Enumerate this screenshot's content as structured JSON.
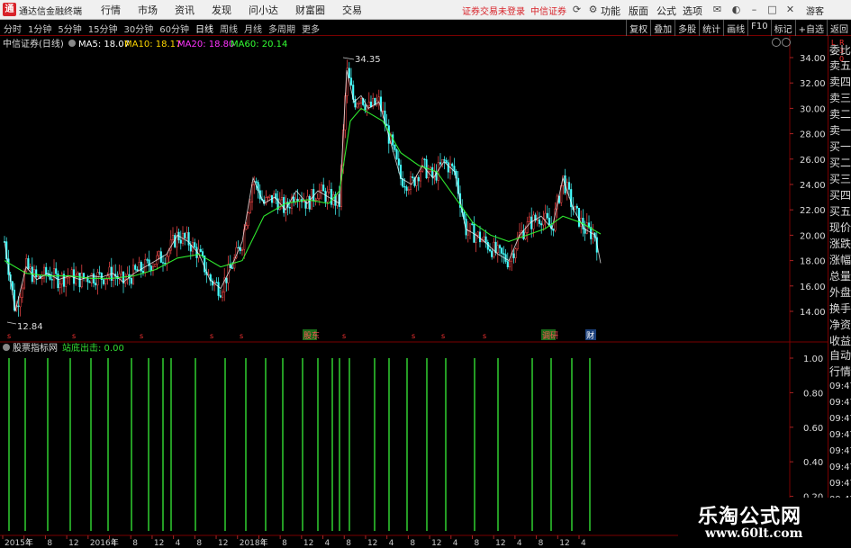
{
  "titlebar": {
    "logo": "通",
    "app_name": "通达信金融终端",
    "menu": [
      "行情",
      "市场",
      "资讯",
      "发现",
      "问小达",
      "财富圈",
      "交易"
    ],
    "status": "证券交易未登录",
    "broker": "中信证券",
    "right_menu": [
      "功能",
      "版面",
      "公式",
      "选项"
    ],
    "guest": "游客"
  },
  "toolbar": {
    "periods": [
      "分时",
      "1分钟",
      "5分钟",
      "15分钟",
      "30分钟",
      "60分钟",
      "日线",
      "周线",
      "月线",
      "多周期",
      "更多"
    ],
    "active_period": "日线",
    "right_buttons": [
      "复权",
      "叠加",
      "多股",
      "统计",
      "画线",
      "F10",
      "标记",
      "+自选",
      "返回"
    ]
  },
  "main_panel": {
    "title": "中信证券(日线)",
    "ma": [
      {
        "label": "MA5: 18.07",
        "color": "#ffffff"
      },
      {
        "label": "MA10: 18.17",
        "color": "#ffd700"
      },
      {
        "label": "MA20: 18.80",
        "color": "#ff33ff"
      },
      {
        "label": "MA60: 20.14",
        "color": "#33ff33"
      }
    ],
    "high_label": "34.35",
    "low_label": "12.84",
    "events": [
      "股东",
      "调研",
      "财"
    ]
  },
  "indicator_panel": {
    "title": "股票指标网",
    "value_label": "站底出击: 0.00"
  },
  "sidebar": {
    "corner": [
      "L",
      "R",
      "3",
      "0"
    ],
    "items": [
      "委比",
      "卖五",
      "卖四",
      "卖三",
      "卖二",
      "卖一",
      "买一",
      "买二",
      "买三",
      "买四",
      "买五",
      "现价",
      "涨跌",
      "涨幅",
      "总量",
      "外盘",
      "换手",
      "净资",
      "收益",
      "自动",
      "行情",
      "09:47",
      "09:47",
      "09:47",
      "09:47",
      "09:47",
      "09:47",
      "09:47",
      "09:47"
    ]
  },
  "x_axis_labels": [
    "2015年",
    "4",
    "8",
    "12",
    "2016年",
    "4",
    "8",
    "12",
    "4",
    "8",
    "12",
    "2018年",
    "4",
    "8",
    "12",
    "4",
    "8",
    "12",
    "4",
    "8",
    "12",
    "4",
    "8",
    "12",
    "4",
    "8",
    "12",
    "4"
  ],
  "watermark": {
    "line1": "乐淘公式网",
    "line2": "www.60lt.com"
  },
  "chart_data": [
    {
      "type": "line",
      "chart_role": "price",
      "y_ticks": [
        34.0,
        32.0,
        30.0,
        28.0,
        26.0,
        24.0,
        22.0,
        20.0,
        18.0,
        16.0,
        14.0
      ],
      "ylim": [
        12.84,
        34.35
      ],
      "series": [
        {
          "name": "MA5",
          "color": "#ffffff",
          "x": [
            0,
            12,
            24,
            36,
            48,
            60,
            72,
            84,
            96,
            108,
            120,
            132,
            144,
            156,
            168,
            180,
            192,
            204,
            216,
            228,
            240,
            252,
            264,
            276,
            288,
            300,
            312,
            324,
            336,
            348,
            360,
            372,
            380,
            388,
            396,
            404,
            416,
            428,
            440,
            452,
            464,
            476,
            488,
            500,
            512,
            524,
            536,
            548,
            560,
            572,
            584,
            596,
            608,
            620,
            632,
            644,
            656,
            662
          ],
          "values": [
            19.5,
            14.0,
            17.5,
            16.5,
            17.0,
            16.5,
            16.8,
            16.5,
            16.8,
            16.7,
            17.0,
            16.3,
            17.0,
            17.5,
            18.0,
            18.5,
            20.0,
            19.5,
            18.5,
            16.5,
            15.8,
            17.5,
            19.5,
            24.5,
            22.5,
            23.0,
            22.0,
            23.5,
            22.5,
            23.5,
            23.0,
            22.5,
            33.0,
            30.5,
            31.0,
            30.0,
            30.5,
            27.5,
            24.5,
            24.0,
            25.5,
            24.5,
            25.8,
            25.0,
            20.5,
            20.0,
            19.3,
            18.5,
            18.0,
            20.0,
            21.0,
            21.5,
            20.5,
            24.5,
            22.0,
            20.5,
            20.0,
            17.8
          ]
        },
        {
          "name": "MA60",
          "color": "#33ff33",
          "x": [
            0,
            24,
            48,
            72,
            96,
            120,
            144,
            168,
            192,
            216,
            240,
            264,
            288,
            312,
            336,
            360,
            372,
            384,
            396,
            408,
            420,
            440,
            460,
            480,
            500,
            520,
            540,
            560,
            580,
            600,
            620,
            640,
            662
          ],
          "values": [
            18.0,
            17.0,
            16.8,
            16.8,
            16.6,
            16.6,
            16.8,
            17.3,
            18.2,
            18.5,
            17.5,
            18.0,
            21.5,
            22.5,
            22.8,
            22.5,
            23.5,
            29.0,
            30.0,
            29.5,
            29.0,
            26.5,
            25.5,
            25.0,
            23.0,
            21.0,
            20.0,
            19.5,
            20.0,
            20.5,
            21.5,
            21.0,
            20.1
          ]
        }
      ]
    },
    {
      "type": "bar",
      "chart_role": "indicator",
      "series_name": "站底出击",
      "color": "#33dd33",
      "y_ticks": [
        1.0,
        0.8,
        0.6,
        0.4,
        0.2
      ],
      "ylim": [
        0,
        1.0
      ],
      "bars_x": [
        5,
        23,
        48,
        73,
        96,
        115,
        141,
        160,
        176,
        185,
        212,
        245,
        268,
        290,
        309,
        331,
        348,
        364,
        372,
        383,
        411,
        427,
        447,
        469,
        490,
        522,
        548,
        586,
        607,
        630,
        650
      ],
      "bars_value": [
        1.0,
        1.0,
        1.0,
        1.0,
        1.0,
        1.0,
        1.0,
        1.0,
        1.0,
        1.0,
        1.0,
        1.0,
        1.0,
        1.0,
        1.0,
        1.0,
        1.0,
        1.0,
        1.0,
        1.0,
        1.0,
        1.0,
        1.0,
        1.0,
        1.0,
        1.0,
        1.0,
        1.0,
        1.0,
        1.0,
        1.0
      ]
    }
  ]
}
